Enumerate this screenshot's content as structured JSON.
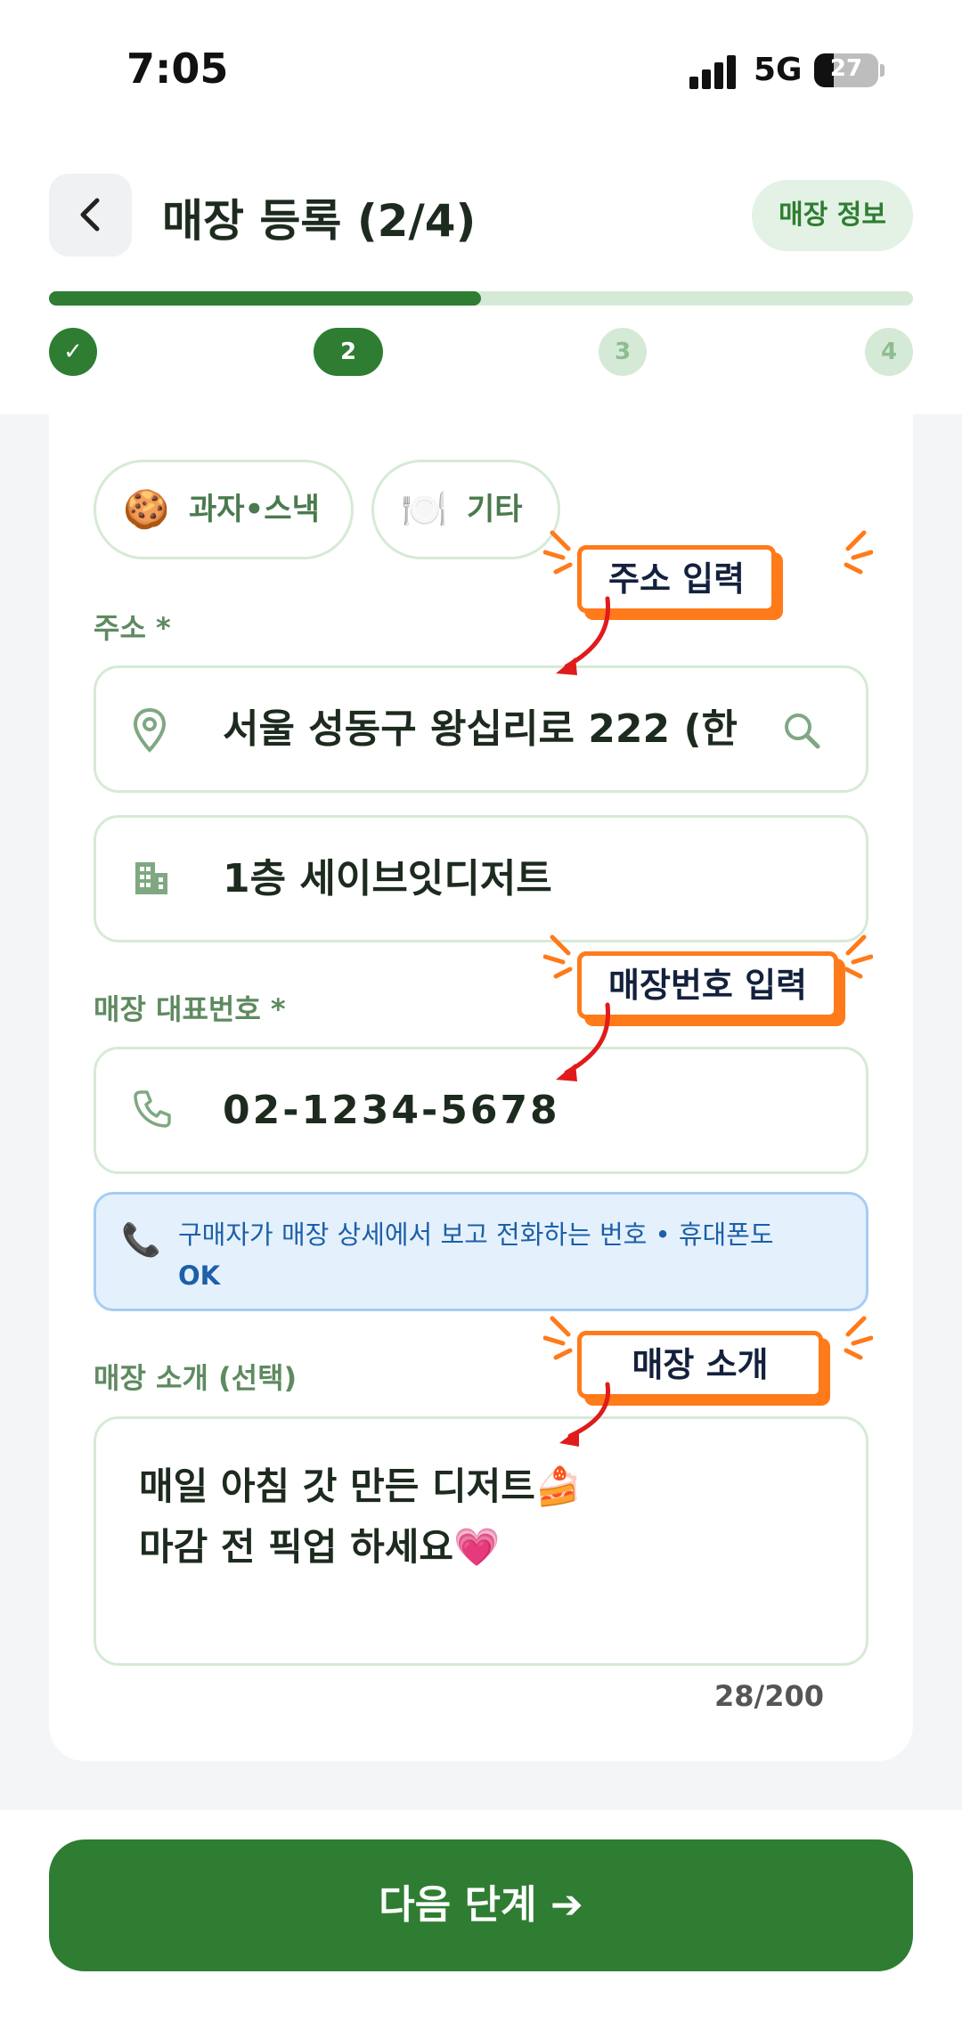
{
  "status_bar": {
    "time": "7:05",
    "network": "5G",
    "battery": "27"
  },
  "header": {
    "title": "매장 등록 (2/4)",
    "info_label": "매장 정보",
    "progress": 0.5,
    "steps": [
      "✓",
      "2",
      "3",
      "4"
    ]
  },
  "categories": [
    {
      "icon": "🍪",
      "label": "과자•스낵"
    },
    {
      "icon": "🍽️",
      "label": "기타"
    }
  ],
  "address": {
    "label": "주소 *",
    "value": "서울 성동구 왕십리로 222 (한",
    "detail": "1층 세이브잇디저트"
  },
  "phone": {
    "label": "매장 대표번호 *",
    "value": "02-1234-5678",
    "hint": "구매자가 매장 상세에서 보고 전화하는 번호 • 휴대폰도",
    "hint_ok": "OK"
  },
  "intro": {
    "label": "매장 소개 (선택)",
    "line1": "매일 아침 갓 만든 디저트🍰",
    "line2": "마감 전 픽업 하세요💗",
    "counter": "28/200"
  },
  "callouts": {
    "address": "주소 입력",
    "phone": "매장번호 입력",
    "intro": "매장 소개"
  },
  "next_button": "다음 단계 ➔",
  "colors": {
    "primary": "#2e7d32",
    "callout": "#ff7a1a",
    "hint_bg": "#e4f1fd"
  }
}
